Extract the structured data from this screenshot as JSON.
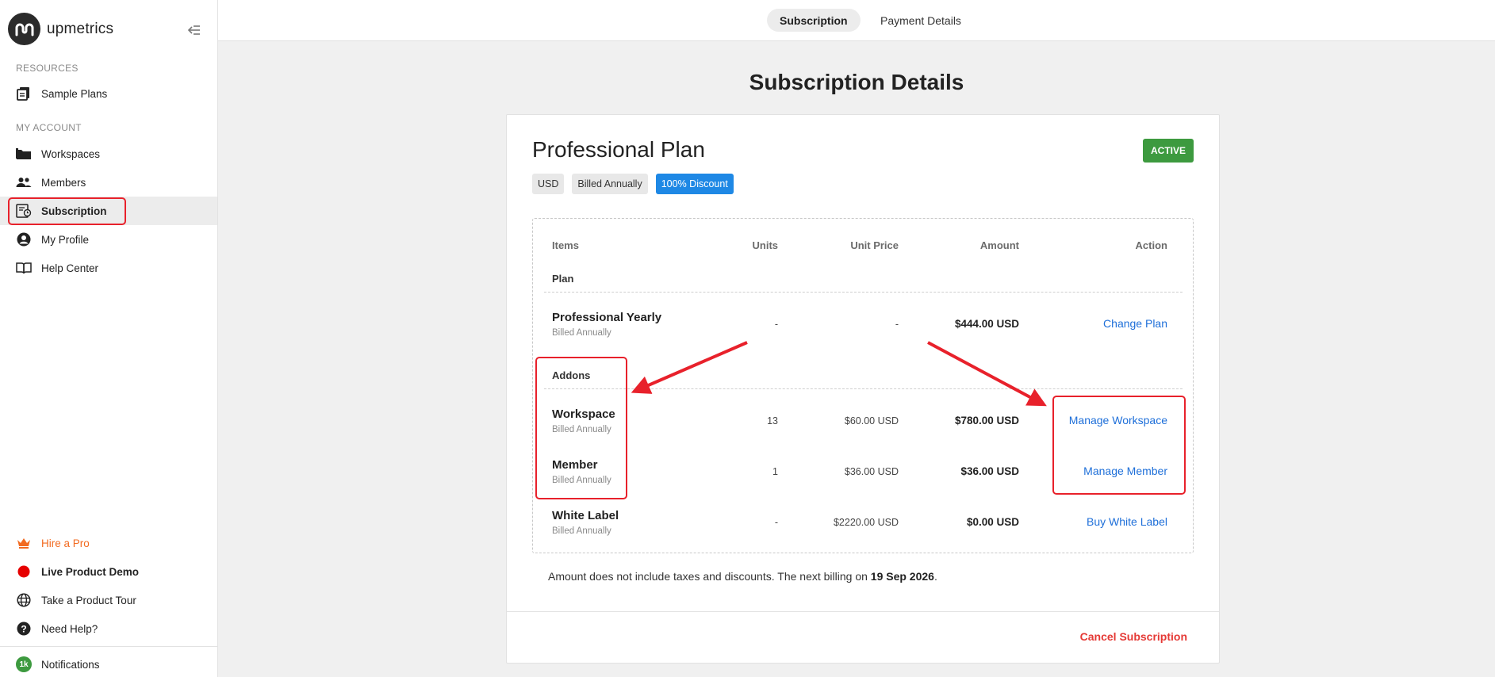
{
  "brand": {
    "name": "upmetrics"
  },
  "sidebar": {
    "resources_label": "RESOURCES",
    "account_label": "MY ACCOUNT",
    "items": [
      {
        "label": "Sample Plans",
        "icon": "document-copy-icon"
      },
      {
        "label": "Workspaces",
        "icon": "folder-icon"
      },
      {
        "label": "Members",
        "icon": "people-icon"
      },
      {
        "label": "Subscription",
        "icon": "receipt-icon"
      },
      {
        "label": "My Profile",
        "icon": "account-circle-icon"
      },
      {
        "label": "Help Center",
        "icon": "book-icon"
      }
    ],
    "bottom_items": [
      {
        "label": "Hire a Pro",
        "icon": "crown-icon"
      },
      {
        "label": "Live Product Demo",
        "icon": "live-dot-icon"
      },
      {
        "label": "Take a Product Tour",
        "icon": "globe-icon"
      },
      {
        "label": "Need Help?",
        "icon": "help-circle-icon"
      },
      {
        "label": "Notifications",
        "icon": "notification-count-badge",
        "badge": "1k"
      }
    ]
  },
  "tabs": [
    {
      "label": "Subscription",
      "active": true
    },
    {
      "label": "Payment Details",
      "active": false
    }
  ],
  "page": {
    "title": "Subscription Details"
  },
  "plan": {
    "name": "Professional Plan",
    "status": "ACTIVE",
    "chips": [
      "USD",
      "Billed Annually",
      "100% Discount"
    ]
  },
  "table": {
    "headers": {
      "items": "Items",
      "units": "Units",
      "unit_price": "Unit Price",
      "amount": "Amount",
      "action": "Action"
    },
    "plan_group": "Plan",
    "addons_group": "Addons",
    "plan_row": {
      "name": "Professional Yearly",
      "sub": "Billed Annually",
      "units": "-",
      "unit_price": "-",
      "amount": "$444.00 USD",
      "action": "Change Plan"
    },
    "addons": [
      {
        "name": "Workspace",
        "sub": "Billed Annually",
        "units": "13",
        "unit_price": "$60.00 USD",
        "amount": "$780.00 USD",
        "action": "Manage Workspace"
      },
      {
        "name": "Member",
        "sub": "Billed Annually",
        "units": "1",
        "unit_price": "$36.00 USD",
        "amount": "$36.00 USD",
        "action": "Manage Member"
      },
      {
        "name": "White Label",
        "sub": "Billed Annually",
        "units": "-",
        "unit_price": "$2220.00 USD",
        "amount": "$0.00 USD",
        "action": "Buy White Label"
      }
    ]
  },
  "footnote": {
    "text": "Amount does not include taxes and discounts. The next billing on ",
    "date": "19 Sep 2026",
    "suffix": "."
  },
  "cancel_label": "Cancel Subscription",
  "colors": {
    "active_green": "#3d9a3f",
    "link_blue": "#1e6fd9",
    "discount_blue": "#1e88e5",
    "cancel_red": "#e53935",
    "annotation_red": "#e8212b",
    "hire_orange": "#f26b21"
  }
}
